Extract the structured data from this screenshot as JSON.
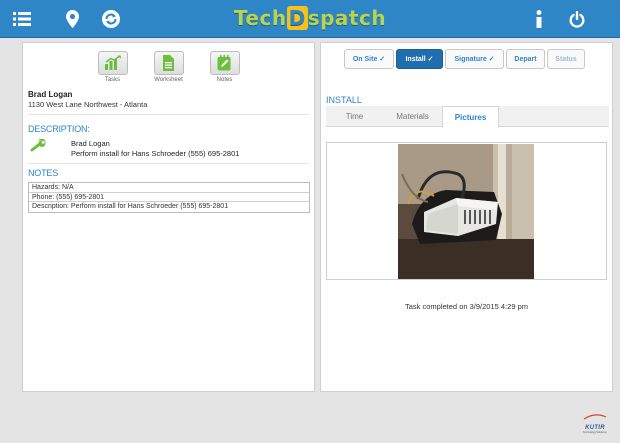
{
  "header": {
    "brand_prefix": "Tech",
    "brand_highlight": "D",
    "brand_suffix": "spatch",
    "icons": [
      "menu-icon",
      "location-pin-icon",
      "sync-icon",
      "info-icon",
      "power-icon"
    ]
  },
  "toolbar": {
    "tasks_label": "Tasks",
    "worksheet_label": "Worksheet",
    "notes_label": "Notes"
  },
  "customer": {
    "name": "Brad Logan",
    "address": "1130 West Lane Northwest - Atlanta"
  },
  "description": {
    "title": "DESCRIPTION:",
    "name": "Brad Logan",
    "text": "Perform install for  Hans Schroeder (555) 695-2801"
  },
  "notes": {
    "title": "NOTES",
    "rows": [
      "Hazards: N/A",
      "Phone: (555) 695-2801",
      "Description: Perform install for  Hans Schroeder (555) 695-2801"
    ]
  },
  "status_steps": [
    {
      "label": "On Site ✓",
      "state": "done"
    },
    {
      "label": "Install ✓",
      "state": "active"
    },
    {
      "label": "Signature ✓",
      "state": "done"
    },
    {
      "label": "Depart",
      "state": "pending"
    },
    {
      "label": "Status",
      "state": "disabled"
    }
  ],
  "install": {
    "title": "INSTALL",
    "tabs": [
      "Time",
      "Materials",
      "Pictures"
    ],
    "active_tab": "Pictures",
    "completed_text": "Task completed on 3/9/2015 4:29 pm"
  },
  "footer": {
    "logo_name": "KUTIR",
    "logo_tagline": "Technology Solutions"
  },
  "colors": {
    "header_blue": "#2e86c7",
    "accent_green": "#6cbf3c",
    "active_button": "#1f6fae"
  }
}
